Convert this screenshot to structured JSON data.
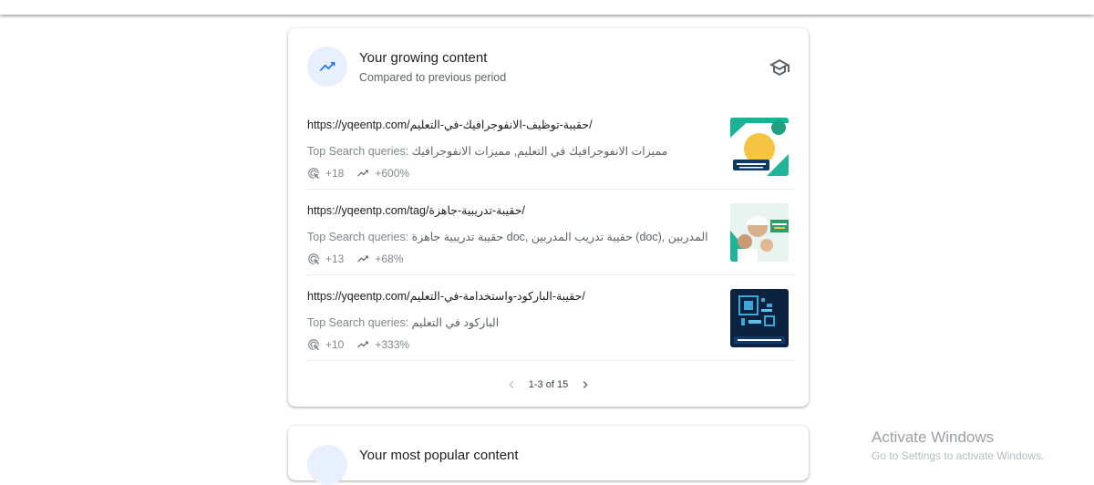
{
  "growing": {
    "title": "Your growing content",
    "subtitle": "Compared to previous period",
    "items": [
      {
        "url": "https://yqeentp.com/حقيبة-توظيف-الانفوجرافيك-في-التعليم/",
        "queries_label": "Top Search queries:",
        "queries": "مميزات الانفوجرافيك في التعليم, مميزات الانفوجرافيك",
        "clicks": "+18",
        "growth": "+600%"
      },
      {
        "url": "https://yqeentp.com/tag/حقيبة-تدريبية-جاهزة/",
        "queries_label": "Top Search queries:",
        "queries": "حقيبة تدريبية جاهزة doc, حقيبة تدريب المدربين (doc), حقيبة تدريب المدربين",
        "clicks": "+13",
        "growth": "+68%"
      },
      {
        "url": "https://yqeentp.com/حقيبة-الباركود-واستخدامة-في-التعليم/",
        "queries_label": "Top Search queries:",
        "queries": "الباركود في التعليم",
        "clicks": "+10",
        "growth": "+333%"
      }
    ],
    "pagination": "1-3 of 15"
  },
  "popular": {
    "title": "Your most popular content"
  },
  "watermark": {
    "line1": "Activate Windows",
    "line2": "Go to Settings to activate Windows."
  },
  "colors": {
    "accent": "#1a73e8",
    "icon_circle": "#e8f0fe",
    "muted_text": "#80868b"
  },
  "icons": {
    "trend": "trending-up-icon",
    "learn": "school-cap-icon",
    "clicks": "click-icon",
    "prev": "chevron-left-icon",
    "next": "chevron-right-icon"
  }
}
